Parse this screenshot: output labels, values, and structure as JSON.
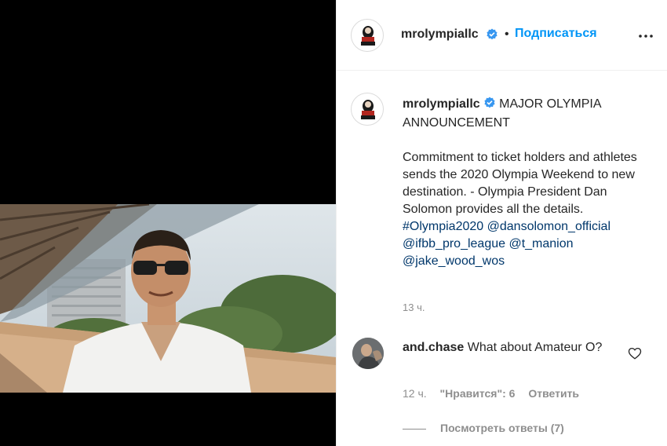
{
  "header": {
    "username": "mrolympiallc",
    "separator": "•",
    "follow_label": "Подписаться"
  },
  "post": {
    "username": "mrolympiallc",
    "caption_text": "MAJOR OLYMPIA\nANNOUNCEMENT\n\nCommitment to ticket holders and athletes sends the 2020 Olympia Weekend to new destination. - Olympia President Dan Solomon provides all the details. ",
    "tags": [
      "#Olympia2020",
      "@dansolomon_official",
      "@ifbb_pro_league",
      "@t_manion",
      "@jake_wood_wos"
    ],
    "time": "13 ч."
  },
  "comment": {
    "username": "and.chase",
    "text": "What about Amateur O?",
    "time": "12 ч.",
    "likes": "\"Нравится\": 6",
    "reply_label": "Ответить",
    "view_replies": "Посмотреть ответы (7)"
  },
  "colors": {
    "accent": "#0095f6",
    "link": "#00376b",
    "verified": "#3897f0",
    "muted": "#8e8e8e"
  },
  "icons": {
    "verified": "verified-badge-icon",
    "more": "more-options-icon",
    "like": "heart-icon"
  }
}
